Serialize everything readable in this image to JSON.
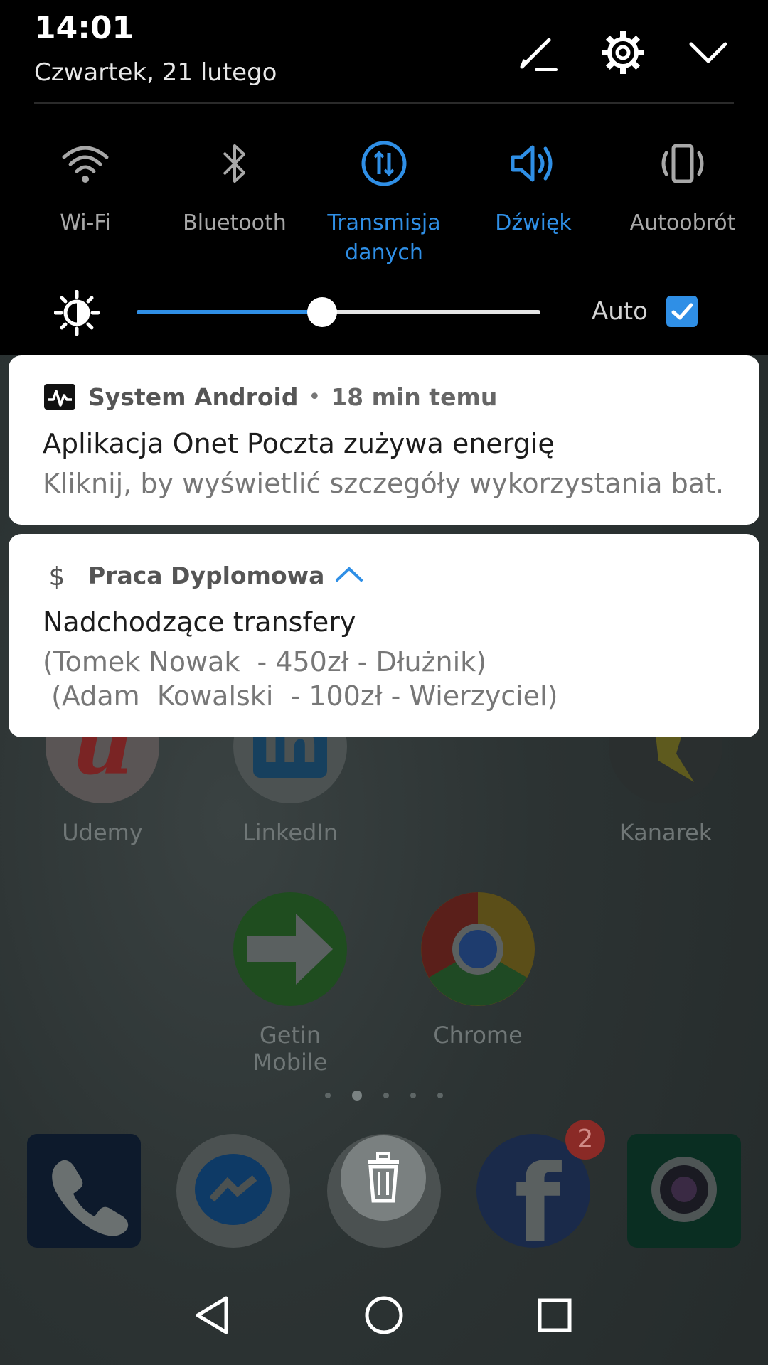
{
  "status": {
    "time": "14:01",
    "date": "Czwartek, 21 lutego"
  },
  "header_icons": [
    "edit-icon",
    "gear-icon",
    "chevron-down-icon"
  ],
  "tiles": [
    {
      "label": "Wi-Fi",
      "icon": "wifi-icon",
      "active": false
    },
    {
      "label": "Bluetooth",
      "icon": "bluetooth-icon",
      "active": false
    },
    {
      "label": "Transmisja danych",
      "icon": "data-transfer-icon",
      "active": true
    },
    {
      "label": "Dźwięk",
      "icon": "sound-icon",
      "active": true
    },
    {
      "label": "Autoobrót",
      "icon": "rotation-icon",
      "active": false
    }
  ],
  "brightness": {
    "level": 0.46,
    "auto_label": "Auto",
    "auto_checked": true
  },
  "notifications": [
    {
      "app": "System Android",
      "time_ago": "18 min temu",
      "title": "Aplikacja Onet Poczta zużywa energię",
      "text": "Kliknij, by wyświetlić szczegóły wykorzystania bat.."
    },
    {
      "app": "Praca Dyplomowa",
      "title": "Nadchodzące transfery",
      "lines": [
        "(Tomek Nowak  - 450zł - Dłużnik)",
        " (Adam  Kowalski  - 100zł - Wierzyciel)"
      ]
    }
  ],
  "home_apps": [
    {
      "label": "Udemy"
    },
    {
      "label": "LinkedIn"
    },
    {
      "label": "Kanarek"
    },
    {
      "label": "Getin Mobile"
    },
    {
      "label": "Chrome"
    }
  ],
  "dock": {
    "facebook_badge": "2"
  },
  "colors": {
    "accent": "#2f8fe6",
    "panel_bg": "#000000",
    "card_bg": "#ffffff"
  }
}
